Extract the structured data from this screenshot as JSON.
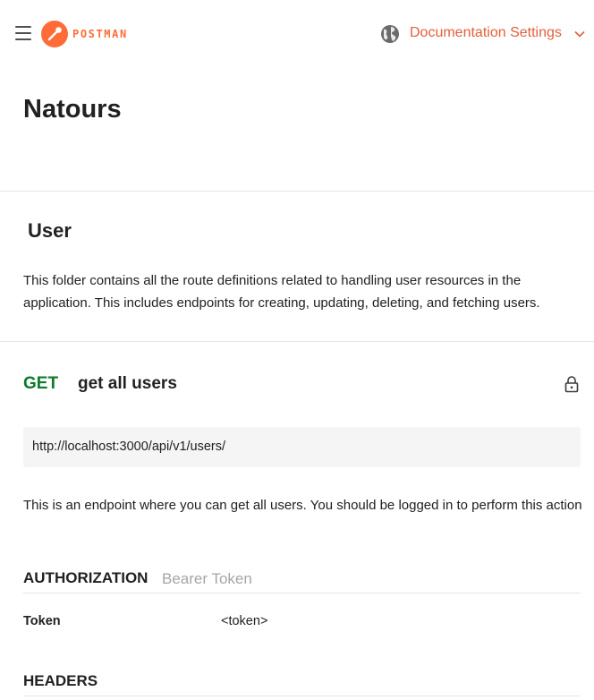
{
  "header": {
    "logo_text": "POSTMAN",
    "settings_label": "Documentation Settings",
    "icons": [
      "menu-icon",
      "postman-logo-icon",
      "globe-icon",
      "chevron-down-icon"
    ]
  },
  "collection": {
    "title": "Natours"
  },
  "folder": {
    "title": "User",
    "description": "This folder contains all the route definitions related to handling user resources in the application. This includes endpoints for creating, updating, deleting, and fetching users."
  },
  "request": {
    "method": "GET",
    "name": "get all users",
    "url": "http://localhost:3000/api/v1/users/",
    "description": "This is an endpoint where you can get all users. You should be logged in to perform this action",
    "authorization": {
      "label": "AUTHORIZATION",
      "type": "Bearer Token",
      "token_key": "Token",
      "token_value": "<token>"
    },
    "headers_label": "HEADERS"
  },
  "colors": {
    "brand": "#ff6c37",
    "settings_text": "#e35f3a",
    "get_method": "#0c7b2b",
    "muted": "#a6a6a6"
  }
}
